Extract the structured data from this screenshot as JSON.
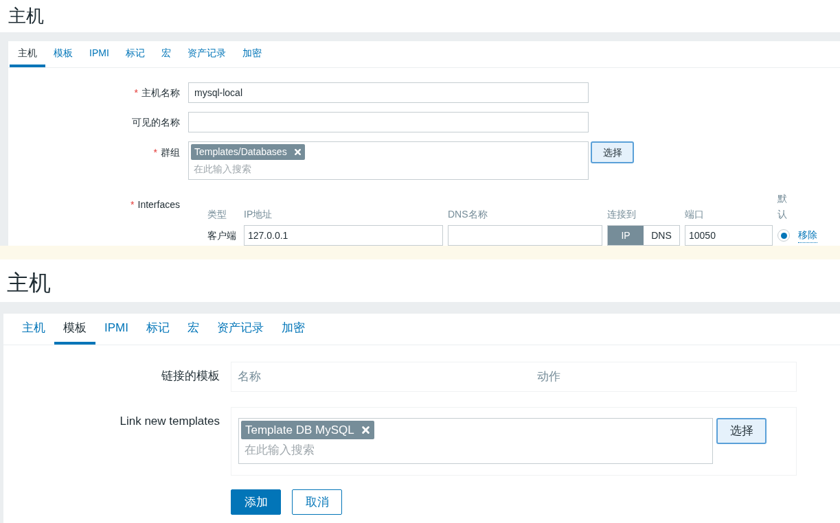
{
  "host_screen": {
    "title": "主机",
    "tabs": [
      {
        "label": "主机",
        "selected": true
      },
      {
        "label": "模板",
        "selected": false
      },
      {
        "label": "IPMI",
        "selected": false
      },
      {
        "label": "标记",
        "selected": false
      },
      {
        "label": "宏",
        "selected": false
      },
      {
        "label": "资产记录",
        "selected": false
      },
      {
        "label": "加密",
        "selected": false
      }
    ],
    "host_name": {
      "marker": "*",
      "label": "主机名称",
      "value": "mysql-local"
    },
    "visible_name": {
      "label": "可见的名称"
    },
    "groups": {
      "marker": "*",
      "label": "群组",
      "tags": [
        "Templates/Databases"
      ],
      "placeholder": "在此输入搜索",
      "select_button": "选择"
    },
    "interfaces": {
      "marker": "*",
      "label": "Interfaces",
      "columns": [
        "类型",
        "IP地址",
        "DNS名称",
        "连接到",
        "端口",
        "默认"
      ],
      "rows": [
        {
          "type": "客户端",
          "ip": "127.0.0.1",
          "connect": [
            {
              "label": "IP",
              "selected": true
            },
            {
              "label": "DNS",
              "selected": false
            }
          ],
          "port": "10050",
          "default": true,
          "remove": "移除"
        }
      ]
    }
  },
  "templates_screen": {
    "title": "主机",
    "tabs": [
      {
        "label": "主机",
        "selected": false
      },
      {
        "label": "模板",
        "selected": true
      },
      {
        "label": "IPMI",
        "selected": false
      },
      {
        "label": "标记",
        "selected": false
      },
      {
        "label": "宏",
        "selected": false
      },
      {
        "label": "资产记录",
        "selected": false
      },
      {
        "label": "加密",
        "selected": false
      }
    ],
    "linked_templates": {
      "label": "链接的模板",
      "columns": [
        "名称",
        "动作"
      ]
    },
    "link_new": {
      "label": "Link new templates",
      "tags": [
        "Template DB MySQL"
      ],
      "placeholder": "在此输入搜索",
      "select_button": "选择"
    },
    "buttons": [
      {
        "label": "添加",
        "kind": "primary"
      },
      {
        "label": "取消",
        "kind": "secondary"
      }
    ]
  }
}
